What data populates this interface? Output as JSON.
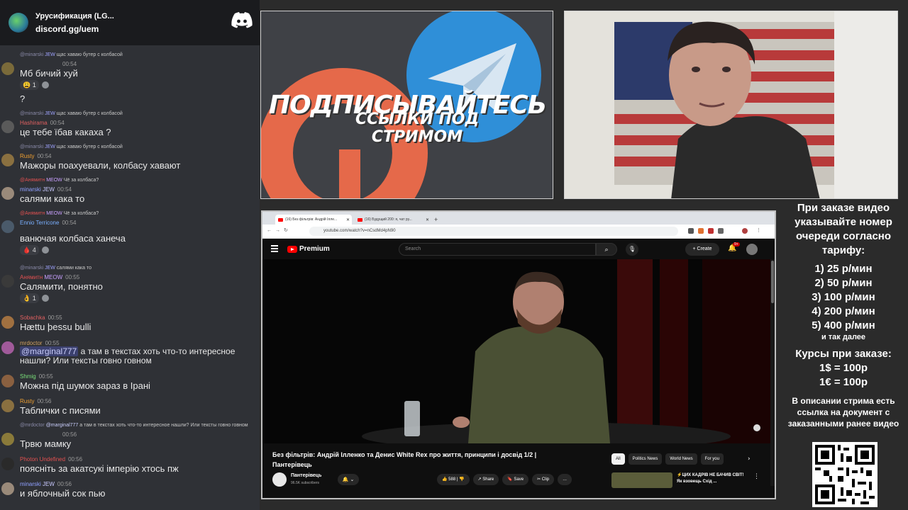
{
  "discord": {
    "server_name": "Урусификация (LG...",
    "invite": "discord.gg/uem",
    "messages": [
      {
        "reply_user": "@minarski",
        "reply_tag": "JEW",
        "reply_text": "щас хаваю бутер с колбасой",
        "user": "",
        "time": "00:54",
        "text": "Мб бичий хуй",
        "reactions": "1",
        "extra": "?"
      },
      {
        "reply_user": "@minarski",
        "reply_tag": "JEW",
        "reply_text": "щас хаваю бутер с колбасой",
        "user": "Hashirama",
        "time": "00:54",
        "text": "це тебе їбав какаха ?"
      },
      {
        "reply_user": "@minarski",
        "reply_tag": "JEW",
        "reply_text": "щас хаваю бутер с колбасой",
        "user": "Rusty",
        "time": "00:54",
        "text": "Мажоры поахуевали, колбасу хавают"
      },
      {
        "reply_user": "@Анямитн",
        "reply_tag": "MEOW",
        "reply_text": "Чё за колбаса?",
        "user": "minarski",
        "user_tag": "JEW",
        "time": "00:54",
        "text": "салями кака то"
      },
      {
        "reply_user": "@Анямитн",
        "reply_tag": "MEOW",
        "reply_text": "Чё за колбаса?",
        "user": "Ennio Terricone",
        "time": "00:54",
        "text": "ванючая колбаса ханеча",
        "reactions": "4"
      },
      {
        "reply_user": "@minarski",
        "reply_tag": "JEW",
        "reply_text": "салями кака то",
        "user": "Анямитн",
        "user_tag": "MEOW",
        "time": "00:55",
        "text": "Салямити, понятно",
        "reactions": "1"
      },
      {
        "user": "Sobachka",
        "time": "00:55",
        "text": "Hættu þessu bulli"
      },
      {
        "user": "mrdoctor",
        "time": "00:55",
        "mention": "@marginal777",
        "text": "а там в текстах хоть что-то интересное нашли? Или тексты говно говном"
      },
      {
        "user": "Shmig",
        "time": "00:55",
        "text": "Можна під шумок зараз в Ірані"
      },
      {
        "user": "Rusty",
        "time": "00:56",
        "text": "Таблички с писями"
      },
      {
        "reply_user": "@mrdoctor",
        "reply_mention": "@marginal777",
        "reply_text": "а там в текстах хоть что-то интересное нашли? Или тексты говно говном",
        "user": "",
        "time": "00:56",
        "text": "Трвю мамку"
      },
      {
        "user": "Photon Undefined",
        "time": "00:56",
        "text": "поясніть за акатсукі імперію хтось пж"
      },
      {
        "user": "minarski",
        "user_tag": "JEW",
        "time": "00:56",
        "text": "и яблочный сок пью"
      }
    ]
  },
  "promo": {
    "title": "ПОДПИСЫВАЙТЕСЬ",
    "subtitle": "ССЫЛКИ ПОД СТРИМОМ"
  },
  "browser": {
    "tab1": "(16) Без фільтрів: Андрій Ілле...",
    "tab2": "(16) Будущий 200: я, чат ру...",
    "url": "youtube.com/watch?v=nCsdMd4pN90",
    "brand": "Premium",
    "search_placeholder": "Search",
    "create": "Create",
    "notif_count": "9+",
    "video_title": "Без фільтрів: Андрій Ілленко та Денис White Rex про життя, принципи і досвід 1/2 | Пантерівець",
    "channel": "Пантерівець",
    "subscribers": "96.5K subscribers",
    "likes": "588",
    "share": "Share",
    "save": "Save",
    "clip": "Clip",
    "chips": [
      "All",
      "Politics News",
      "World News",
      "For you"
    ],
    "rec_title": "⚡ЦИХ КАДРІВ НЕ БАЧИВ СВІТ! Як взовещь Схід ..."
  },
  "info": {
    "intro": "При заказе видео указывайте номер очереди согласно тарифу:",
    "tariffs": [
      "1) 25 р/мин",
      "2) 50 р/мин",
      "3) 100 р/мин",
      "4) 200 р/мин",
      "5) 400 р/мин"
    ],
    "etc": "и так далее",
    "rates_title": "Курсы при заказе:",
    "rates": [
      "1$ = 100р",
      "1€ = 100р"
    ],
    "description": "В описании стрима есть ссылка на документ с заказанными ранее видео"
  },
  "colors": {
    "discord_bg": "#2f3136",
    "youtube_red": "#ff0000",
    "telegram_blue": "#2f8fd8",
    "patreon_orange": "#e5694a"
  }
}
